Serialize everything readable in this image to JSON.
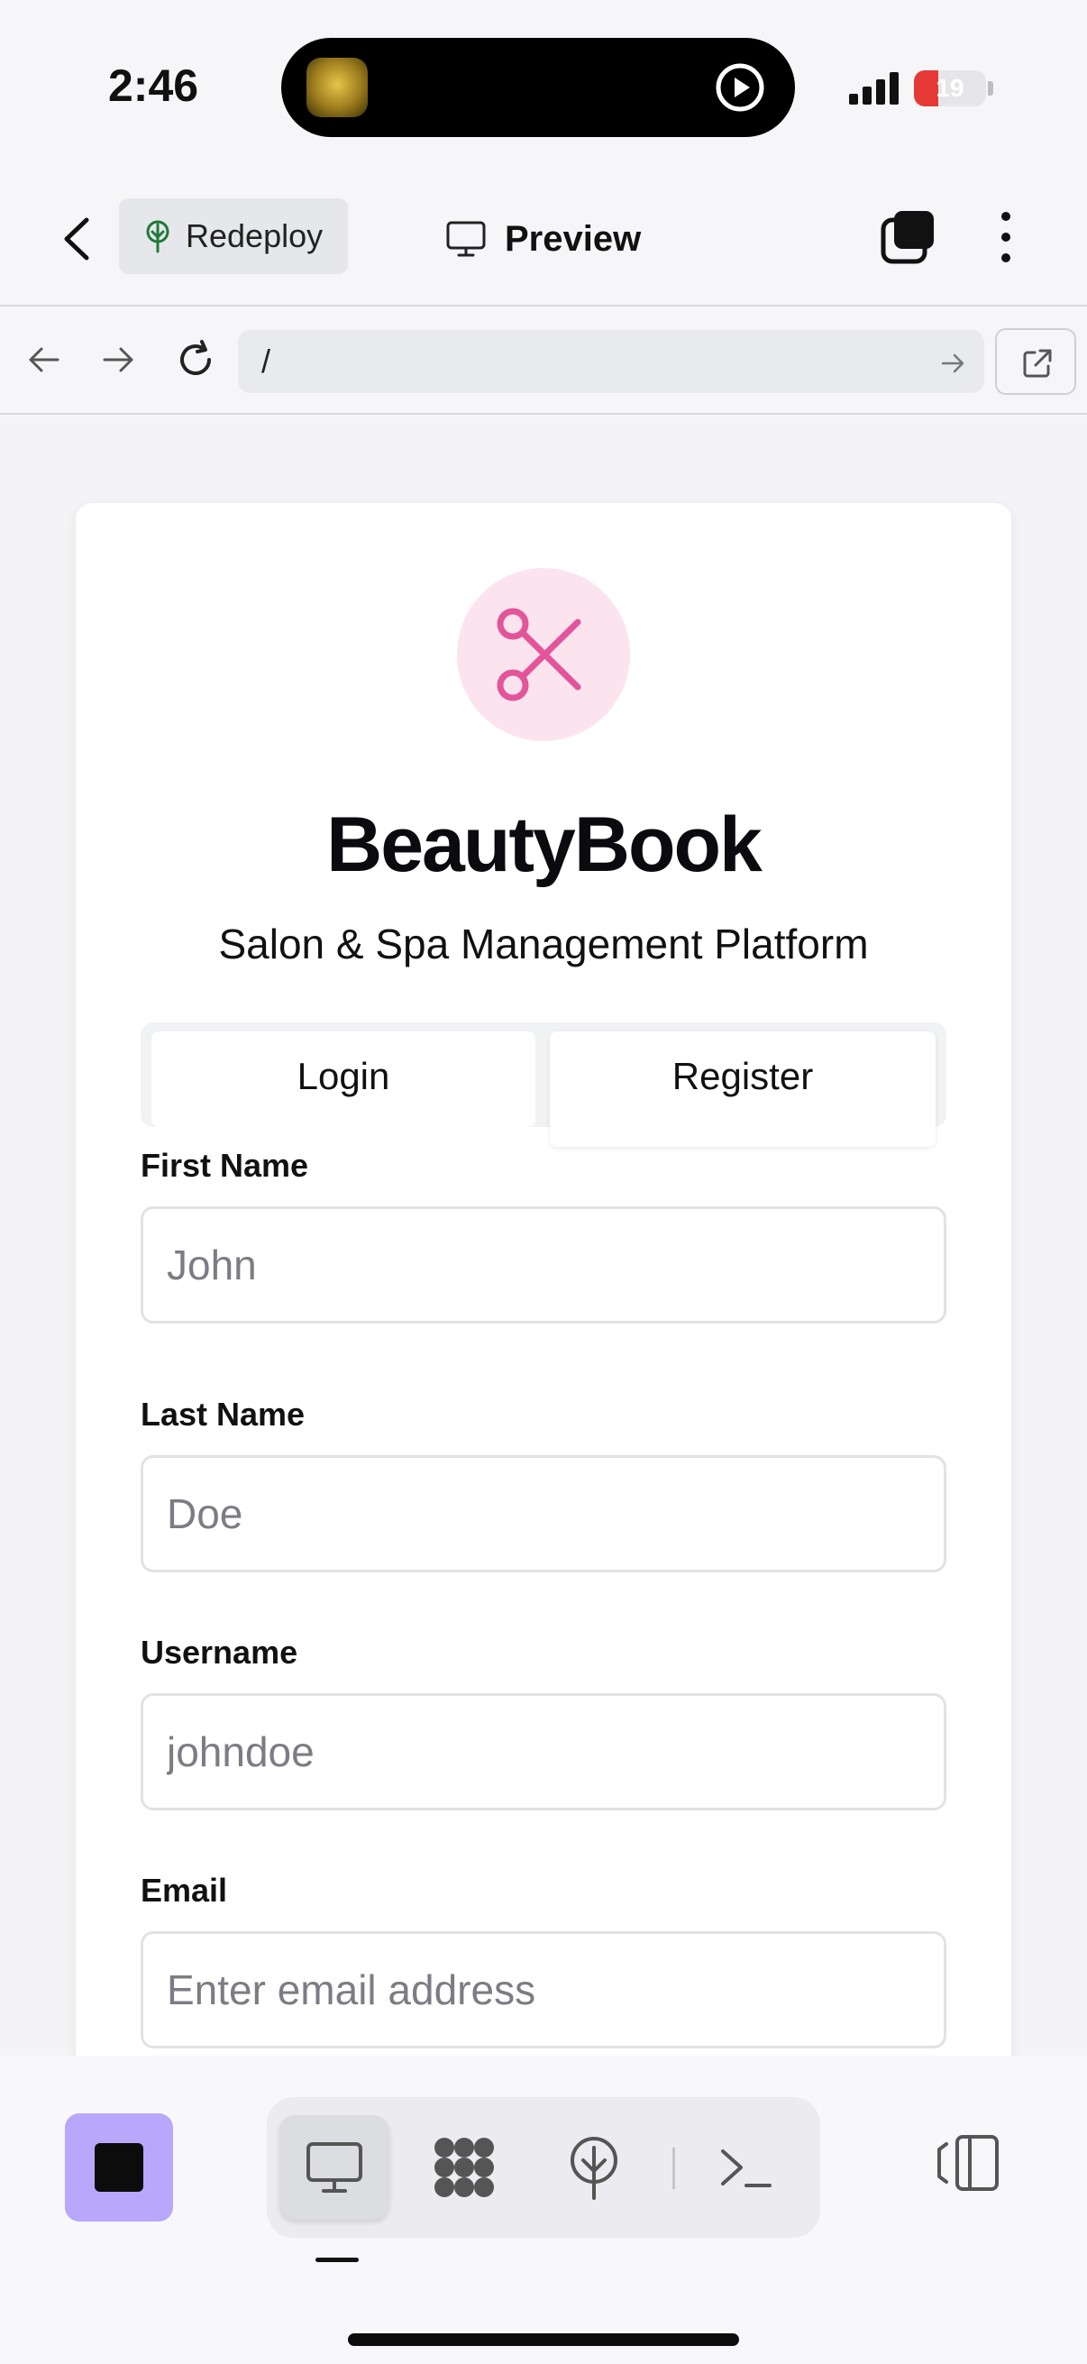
{
  "status_bar": {
    "time": "2:46",
    "battery_level": "19",
    "battery_fraction": 0.19
  },
  "app_bar": {
    "redeploy_label": "Redeploy",
    "preview_label": "Preview"
  },
  "url_bar": {
    "url": "/"
  },
  "brand": {
    "title": "BeautyBook",
    "subtitle": "Salon & Spa Management Platform",
    "accent_color": "#e3559a"
  },
  "tabs": {
    "login_label": "Login",
    "register_label": "Register",
    "selected": "Register"
  },
  "form": {
    "first_name_label": "First Name",
    "first_name_placeholder": "John",
    "last_name_label": "Last Name",
    "last_name_placeholder": "Doe",
    "username_label": "Username",
    "username_placeholder": "johndoe",
    "email_label": "Email",
    "email_placeholder": "Enter email address"
  },
  "bottom_bar": {
    "stop_color": "#b8a7fb",
    "tools": [
      "monitor-icon",
      "apps-icon",
      "deploy-icon",
      "terminal-icon"
    ],
    "active_tool": "monitor-icon"
  }
}
